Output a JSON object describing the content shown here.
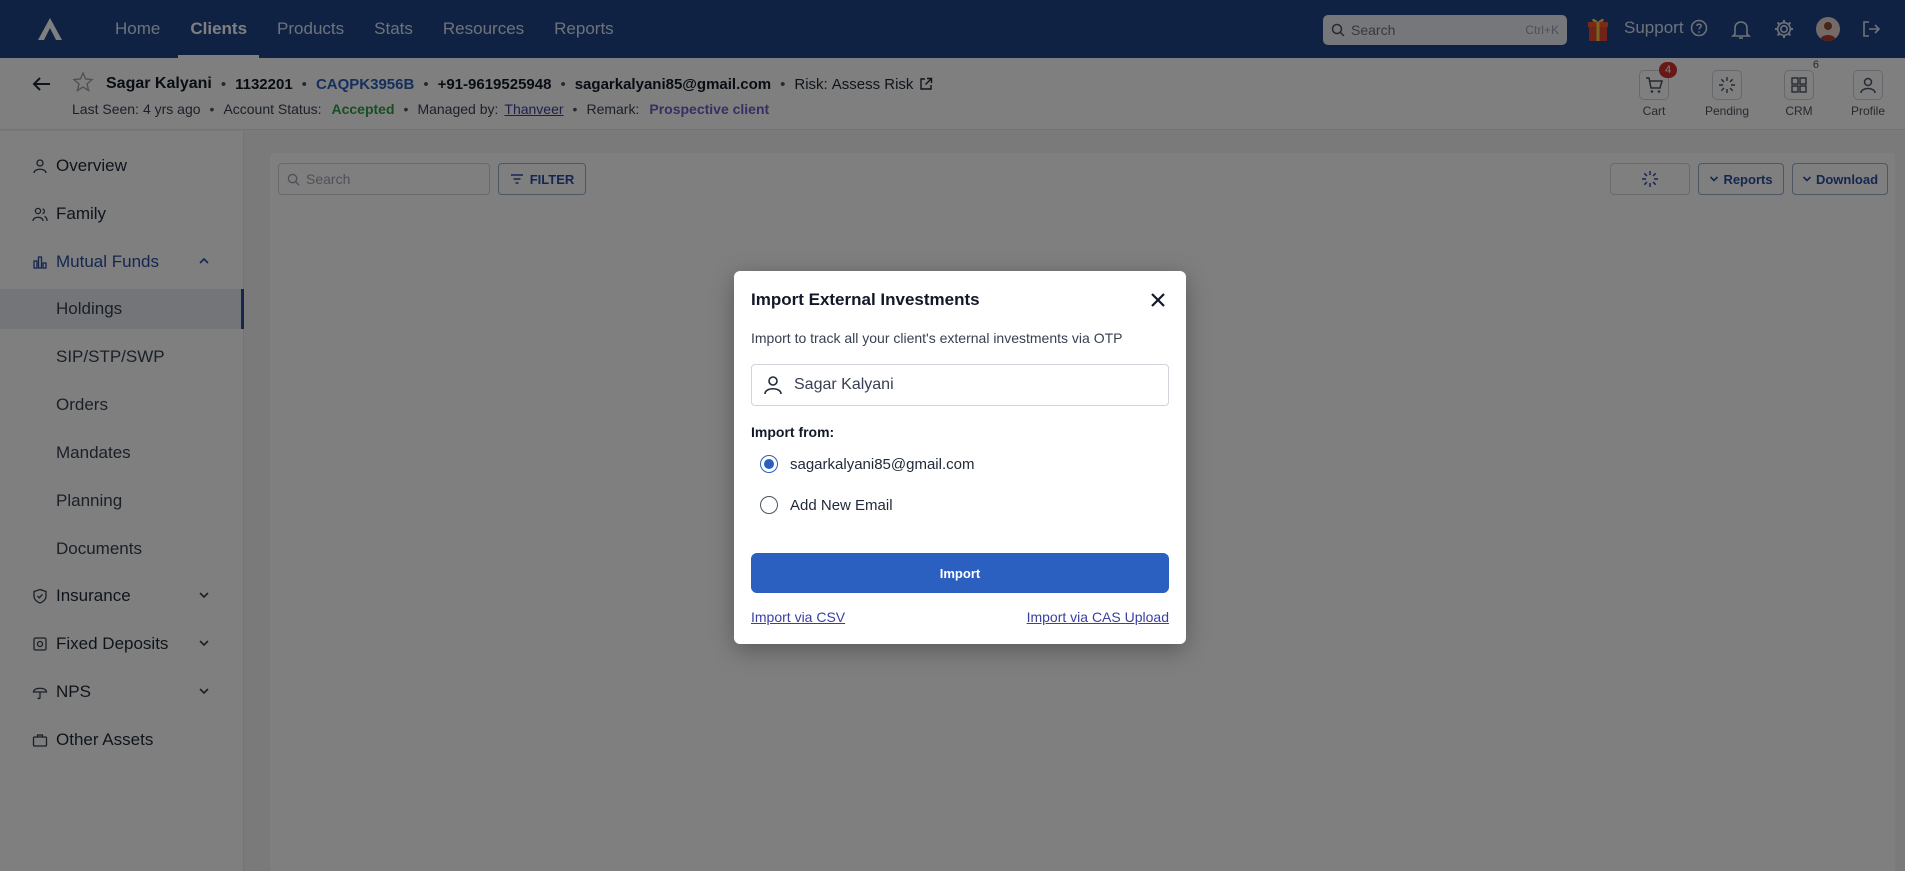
{
  "topnav": {
    "items": [
      {
        "label": "Home",
        "active": false
      },
      {
        "label": "Clients",
        "active": true
      },
      {
        "label": "Products",
        "active": false
      },
      {
        "label": "Stats",
        "active": false
      },
      {
        "label": "Resources",
        "active": false
      },
      {
        "label": "Reports",
        "active": false
      }
    ],
    "search_placeholder": "Search",
    "search_shortcut": "Ctrl+K",
    "support_label": "Support"
  },
  "client": {
    "name": "Sagar Kalyani",
    "id": "1132201",
    "pan": "CAQPK3956B",
    "phone": "+91-9619525948",
    "email": "sagarkalyani85@gmail.com",
    "risk_label": "Risk:",
    "risk_value": "Assess Risk",
    "last_seen_label": "Last Seen:",
    "last_seen_value": "4 yrs ago",
    "status_label": "Account Status:",
    "status_value": "Accepted",
    "managed_label": "Managed by:",
    "managed_value": "Thanveer",
    "remark_label": "Remark:",
    "remark_value": "Prospective client"
  },
  "header_tools": {
    "cart": {
      "label": "Cart",
      "badge": "4"
    },
    "pending": {
      "label": "Pending"
    },
    "crm": {
      "label": "CRM",
      "count": "6"
    },
    "profile": {
      "label": "Profile"
    }
  },
  "sidebar": {
    "overview": "Overview",
    "family": "Family",
    "mutual_funds": "Mutual Funds",
    "sub": [
      "Holdings",
      "SIP/STP/SWP",
      "Orders",
      "Mandates",
      "Planning",
      "Documents"
    ],
    "insurance": "Insurance",
    "fixed_deposits": "Fixed Deposits",
    "nps": "NPS",
    "other_assets": "Other Assets"
  },
  "main": {
    "search_placeholder": "Search",
    "filter_label": "FILTER",
    "reports_label": "Reports",
    "download_label": "Download"
  },
  "modal": {
    "title": "Import External Investments",
    "description": "Import to track all your client's external investments via OTP",
    "client_name": "Sagar Kalyani",
    "import_from_label": "Import from:",
    "options": [
      {
        "label": "sagarkalyani85@gmail.com",
        "selected": true
      },
      {
        "label": "Add New Email",
        "selected": false
      }
    ],
    "import_button": "Import",
    "csv_link": "Import via CSV",
    "cas_link": "Import via CAS Upload"
  },
  "colors": {
    "nav_bg": "#1f4486",
    "accent": "#2b5fc0",
    "accepted": "#2e9e45",
    "remark": "#6b5fc7",
    "badge": "#d32f2f"
  }
}
